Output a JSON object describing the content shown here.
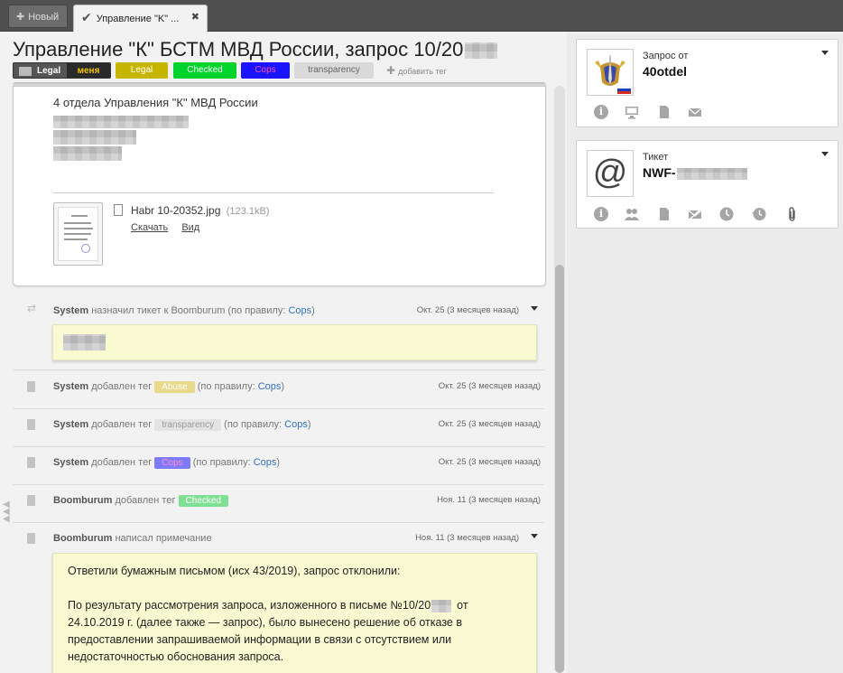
{
  "tabs": [
    {
      "label": "Новый"
    },
    {
      "label": "Управление \"K\" ..."
    }
  ],
  "ticket": {
    "title": "Управление \"К\" БСТМ МВД России, запрос 10/20",
    "tags": {
      "legal": "Legal",
      "legal_me": "меня",
      "yellow": "Legal",
      "green": "Checked",
      "blue": "Cops",
      "gray": "transparency",
      "add": "добавить тег"
    }
  },
  "message": {
    "line1": "4 отдела Управления \"К\" МВД России",
    "file_name": "Habr 10-20352.jpg",
    "file_size": "(123.1kB)",
    "download": "Скачать",
    "view": "Вид"
  },
  "feed": [
    {
      "author": "System",
      "action": "назначил тикет к Boomburum (по правилу:",
      "rule": "Cops",
      "close": ")",
      "date": "Окт. 25 (3 месяцев назад)"
    },
    {
      "author": "System",
      "action": "добавлен тег",
      "tag": "Abuse",
      "rule_prefix": "(по правилу:",
      "rule": "Cops",
      "close": ")",
      "date": "Окт. 25 (3 месяцев назад)"
    },
    {
      "author": "System",
      "action": "добавлен тег",
      "tag": "transparency",
      "rule_prefix": "(по правилу:",
      "rule": "Cops",
      "close": ")",
      "date": "Окт. 25 (3 месяцев назад)"
    },
    {
      "author": "System",
      "action": "добавлен тег",
      "tag": "Cops",
      "rule_prefix": "(по правилу:",
      "rule": "Cops",
      "close": ")",
      "date": "Окт. 25 (3 месяцев назад)"
    },
    {
      "author": "Boomburum",
      "action": "добавлен тег",
      "tag": "Checked",
      "date": "Ноя. 11 (3 месяцев назад)"
    },
    {
      "author": "Boomburum",
      "action": "написал примечание",
      "date": "Ноя. 11 (3 месяцев назад)"
    }
  ],
  "note": {
    "p1": "Ответили бумажным письмом (исх 43/2019), запрос отклонили:",
    "p2a": "По результату рассмотрения запроса, изложенного в письме №10/20",
    "p2b": "от",
    "p2c": "24.10.2019 г. (далее также — запрос), было вынесено решение об отказе в",
    "p2d": "предоставлении запрашиваемой информации в связи с отсутствием или",
    "p2e": "недостаточностью обоснования запроса."
  },
  "sidebar": {
    "requester": {
      "label": "Запрос от",
      "name": "40otdel"
    },
    "ticket": {
      "label": "Тикет",
      "id": "NWF-"
    }
  },
  "colors": {
    "tag_yellow": "#c6b600",
    "tag_green": "#00d32c",
    "tag_blue": "#1a14ff",
    "link": "#2e72c0",
    "note_bg": "#fafad2"
  }
}
